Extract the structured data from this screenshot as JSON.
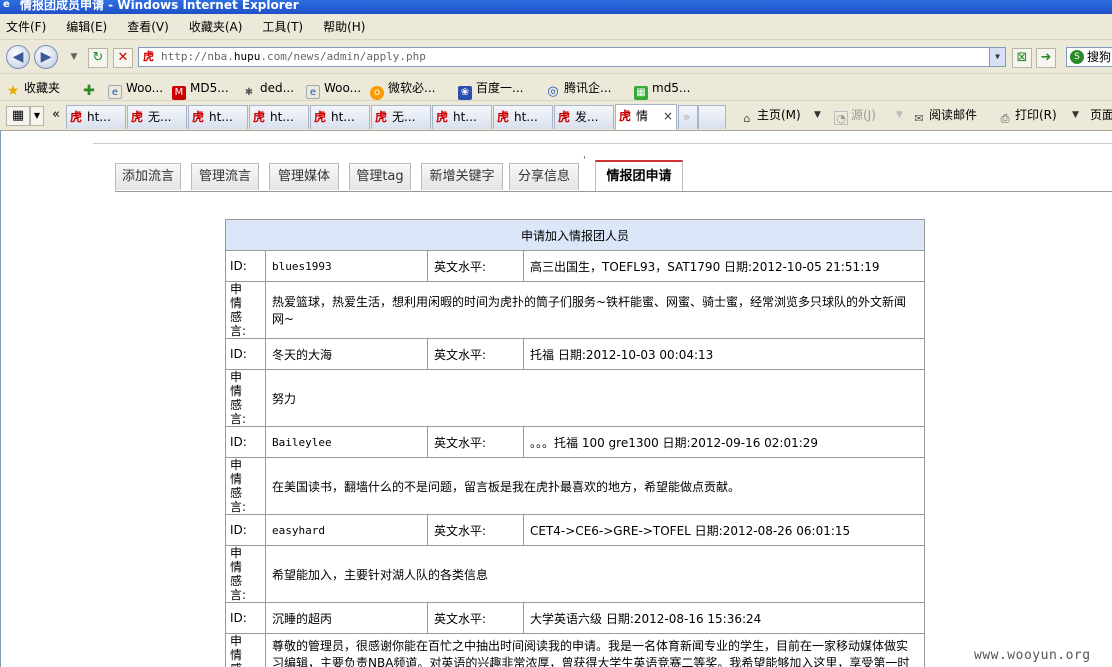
{
  "window": {
    "title": "情报团成员申请 - Windows Internet Explorer"
  },
  "menu": [
    "文件(F)",
    "编辑(E)",
    "查看(V)",
    "收藏夹(A)",
    "工具(T)",
    "帮助(H)"
  ],
  "address": {
    "prefix": "http://nba.",
    "host": "hupu",
    "suffix": ".com/news/admin/apply.php"
  },
  "search": {
    "label": "搜狗"
  },
  "favorites": {
    "label": "收藏夹",
    "items": [
      "Woo...",
      "MD5...",
      "ded...",
      "Woo...",
      "微软必...",
      "百度一...",
      "腾讯企...",
      "md5..."
    ]
  },
  "browser_tabs": {
    "items": [
      "ht...",
      "无...",
      "ht...",
      "ht...",
      "ht...",
      "无...",
      "ht...",
      "ht...",
      "发...",
      "情"
    ],
    "close": "×",
    "more": "»",
    "back": "«"
  },
  "toolbar": {
    "home": "主页(M)",
    "feeds": "源(J)",
    "mail": "阅读邮件",
    "print": "打印(R)",
    "page": "页面"
  },
  "page": {
    "apostrophe": "'",
    "tabs": [
      "添加流言",
      "管理流言",
      "管理媒体",
      "管理tag",
      "新增关键字",
      "分享信息",
      "情报团申请"
    ],
    "table_title": "申请加入情报团人员",
    "labels": {
      "id": "ID:",
      "english": "英文水平:",
      "note": "申情感言:"
    },
    "applicants": [
      {
        "id": "blues1993",
        "english": "高三出国生，TOEFL93，SAT1790 日期:2012-10-05 21:51:19",
        "note": "热爱篮球，热爱生活，想利用闲暇的时间为虎扑的筒子们服务~铁杆能蜜、网蜜、骑士蜜，经常浏览多只球队的外文新闻网~"
      },
      {
        "id": "冬天的大海",
        "english": "托福 日期:2012-10-03 00:04:13",
        "note": "努力"
      },
      {
        "id": "Baileylee",
        "english": "。。。托福 100 gre1300 日期:2012-09-16 02:01:29",
        "note": "在美国读书，翻墙什么的不是问题，留言板是我在虎扑最喜欢的地方，希望能做点贡献。"
      },
      {
        "id": "easyhard",
        "english": "CET4->CE6->GRE->TOFEL 日期:2012-08-26 06:01:15",
        "note": "希望能加入，主要针对湖人队的各类信息"
      },
      {
        "id": "沉睡的超丙",
        "english": "大学英语六级 日期:2012-08-16 15:36:24",
        "note": "尊敬的管理员，很感谢你能在百忙之中抽出时间阅读我的申请。我是一名体育新闻专业的学生，目前在一家移动媒体做实习编辑，主要负责NBA频道。对英语的兴趣非常浓厚，曾获得大学生英语竞赛二等奖。我希望能够加入这里，享受第一时间获取信息的快感，同时希望各位网友指正纠错，提升自己的翻译水平。"
      }
    ]
  },
  "watermark": "www.wooyun.org"
}
